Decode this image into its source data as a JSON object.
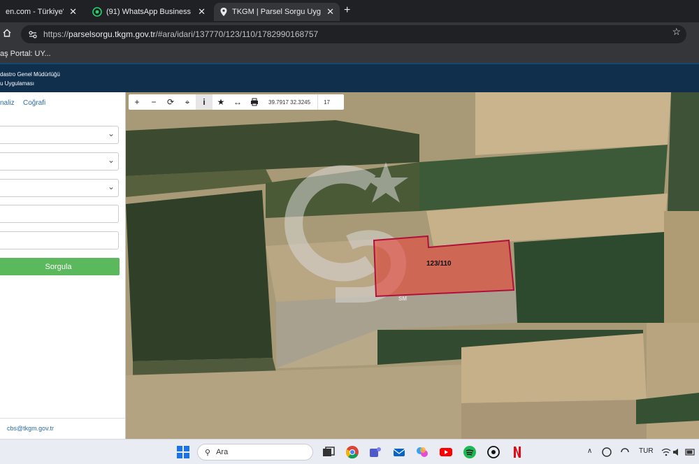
{
  "browser": {
    "tabs": [
      {
        "label": "en.com - Türkiye'nin Or",
        "icon": "generic-site-icon"
      },
      {
        "label": "(91) WhatsApp Business",
        "icon": "whatsapp-icon"
      },
      {
        "label": "TKGM | Parsel Sorgu Uygulamas",
        "icon": "map-pin-icon"
      }
    ],
    "close_symbol": "✕",
    "new_tab_symbol": "+",
    "url_prefix": "https://",
    "url_host": "parselsorgu.tkgm.gov.tr",
    "url_path": "/#ara/idari/137770/123/110/1782990168757",
    "bookmark": "aş Portal: UY..."
  },
  "site": {
    "header_line1": "dastro Genel Müdürlüğü",
    "header_line2": "u Uygulaması"
  },
  "sidebar": {
    "tab_analiz": "naliz",
    "tab_cografi": "Coğrafi",
    "search_button": "Sorgula",
    "email": "cbs@tkgm.gov.tr"
  },
  "map": {
    "coordinates": "39.7917   32.3245",
    "zoom_level": "17",
    "parcel_label": "123/110",
    "watermark_text": "SM",
    "parcel_color": "#e8463c"
  },
  "taskbar": {
    "search_placeholder": "Ara",
    "language": "TUR",
    "chevron": "∧"
  }
}
